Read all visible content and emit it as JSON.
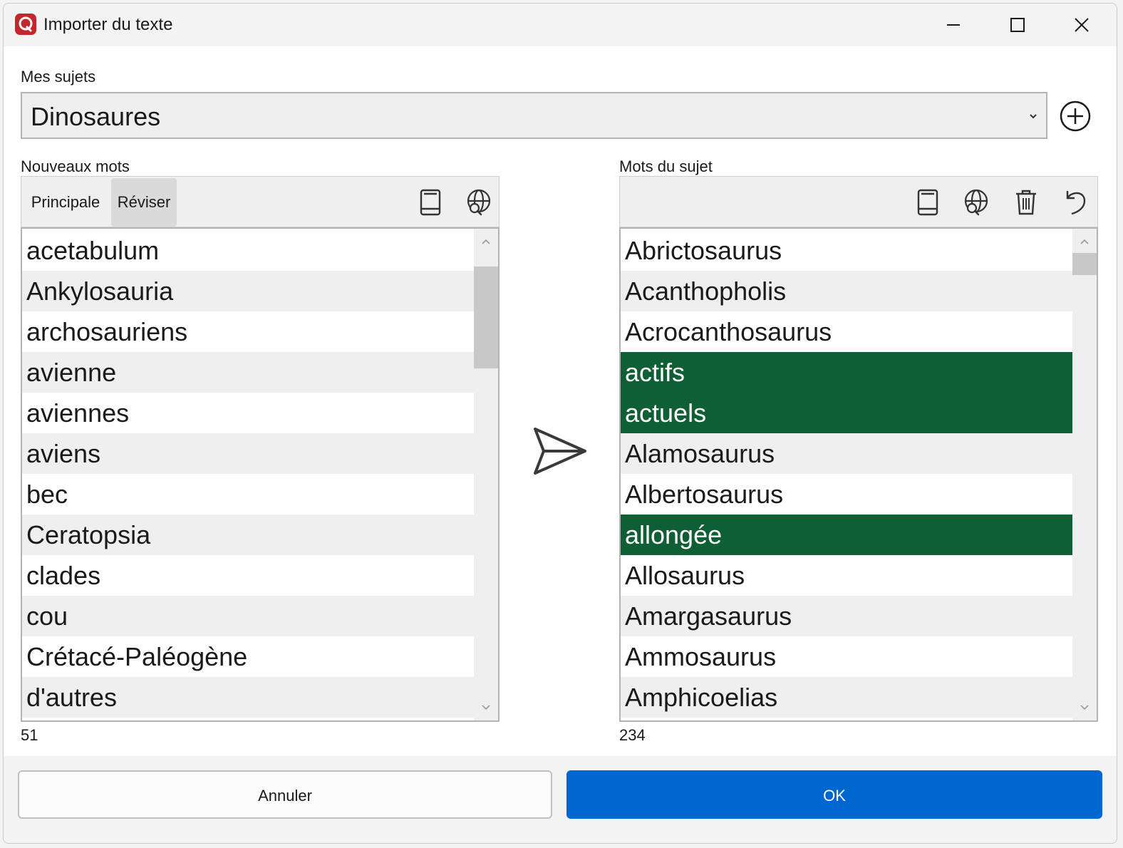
{
  "window": {
    "title": "Importer du texte",
    "controls": [
      "minimize",
      "maximize",
      "close"
    ]
  },
  "subjects": {
    "label": "Mes sujets",
    "selected": "Dinosaures",
    "add_icon": "plus-circle-icon"
  },
  "new_words": {
    "label": "Nouveaux mots",
    "tabs": [
      {
        "label": "Principale",
        "active": false
      },
      {
        "label": "Réviser",
        "active": true
      }
    ],
    "toolbar_icons": [
      "book-icon",
      "globe-search-icon"
    ],
    "items": [
      "acetabulum",
      "Ankylosauria",
      "archosauriens",
      "avienne",
      "aviennes",
      "aviens",
      "bec",
      "Ceratopsia",
      "clades",
      "cou",
      "Crétacé-Paléogène",
      "d'autres"
    ],
    "count": "51",
    "scroll_position": 0.03,
    "scroll_visible_fraction": 0.23
  },
  "subject_words": {
    "label": "Mots du sujet",
    "toolbar_icons": [
      "book-icon",
      "globe-search-icon",
      "trash-icon",
      "undo-icon"
    ],
    "items": [
      "Abrictosaurus",
      "Acanthopholis",
      "Acrocanthosaurus",
      "actifs",
      "actuels",
      "Alamosaurus",
      "Albertosaurus",
      "allongée",
      "Allosaurus",
      "Amargasaurus",
      "Ammosaurus",
      "Amphicoelias"
    ],
    "highlighted": [
      "actifs",
      "actuels",
      "allongée"
    ],
    "count": "234",
    "scroll_position": 0.0,
    "scroll_visible_fraction": 0.05
  },
  "transfer_icon": "send-arrow-icon",
  "buttons": {
    "cancel": "Annuler",
    "ok": "OK"
  },
  "colors": {
    "highlight": "#0f5f34",
    "primary_button": "#0067d0",
    "app_icon": "#c4262e"
  }
}
